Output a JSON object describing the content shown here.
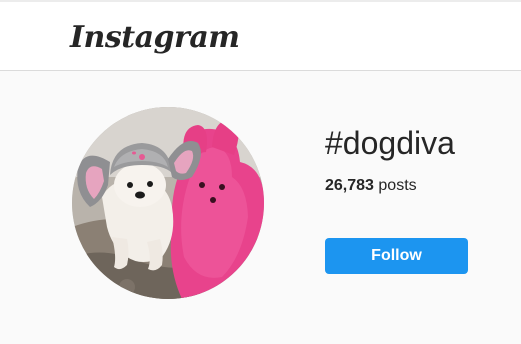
{
  "header": {
    "logo_text": "Instagram"
  },
  "hashtag": {
    "title": "#dogdiva",
    "post_count": "26,783",
    "posts_label": "posts",
    "follow_label": "Follow"
  },
  "colors": {
    "background": "#fafafa",
    "header_background": "#ffffff",
    "divider": "#dbdbdb",
    "text": "#262626",
    "follow_button": "#1c95f0",
    "follow_text": "#ffffff"
  },
  "icons": {
    "avatar": "dog-in-bunny-hat-with-pink-peeps-avatar"
  }
}
